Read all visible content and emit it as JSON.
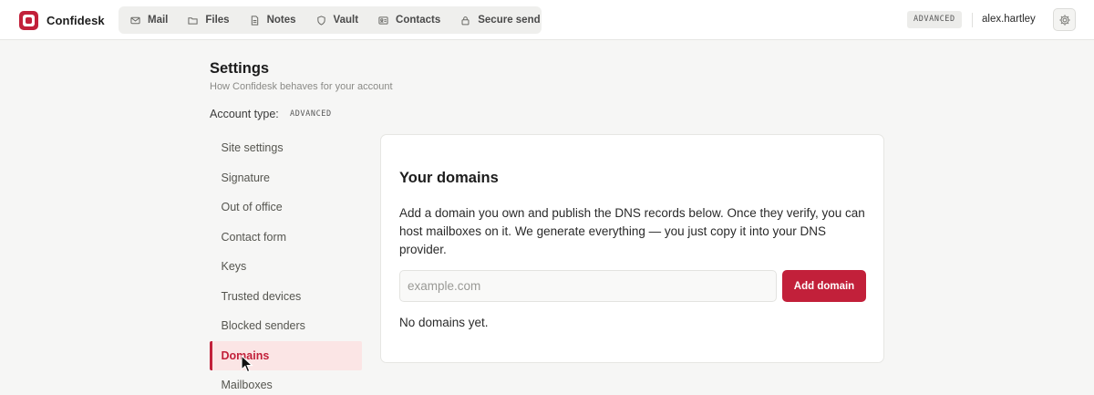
{
  "app": {
    "name": "Confidesk",
    "brand_color": "#c2203a"
  },
  "nav": {
    "items": [
      {
        "label": "Mail",
        "icon": "mail-icon"
      },
      {
        "label": "Files",
        "icon": "folder-icon"
      },
      {
        "label": "Notes",
        "icon": "note-icon"
      },
      {
        "label": "Vault",
        "icon": "shield-icon"
      },
      {
        "label": "Contacts",
        "icon": "contact-card-icon"
      },
      {
        "label": "Secure send",
        "icon": "lock-icon"
      }
    ]
  },
  "header": {
    "badge": "ADVANCED",
    "username": "alex.hartley",
    "settings_icon": "gear-icon"
  },
  "page": {
    "title": "Settings",
    "subtitle": "How Confidesk behaves for your account",
    "account_type_label": "Account type:",
    "account_type_value": "ADVANCED"
  },
  "sidebar": {
    "items": [
      {
        "label": "Site settings",
        "active": false
      },
      {
        "label": "Signature",
        "active": false
      },
      {
        "label": "Out of office",
        "active": false
      },
      {
        "label": "Contact form",
        "active": false
      },
      {
        "label": "Keys",
        "active": false
      },
      {
        "label": "Trusted devices",
        "active": false
      },
      {
        "label": "Blocked senders",
        "active": false
      },
      {
        "label": "Domains",
        "active": true
      },
      {
        "label": "Mailboxes",
        "active": false
      }
    ]
  },
  "domains": {
    "title": "Your domains",
    "description": "Add a domain you own and publish the DNS records below. Once they verify, you can host mailboxes on it. We generate everything — you just copy it into your DNS provider.",
    "input_placeholder": "example.com",
    "input_value": "",
    "add_button_label": "Add domain",
    "empty_text": "No domains yet."
  }
}
